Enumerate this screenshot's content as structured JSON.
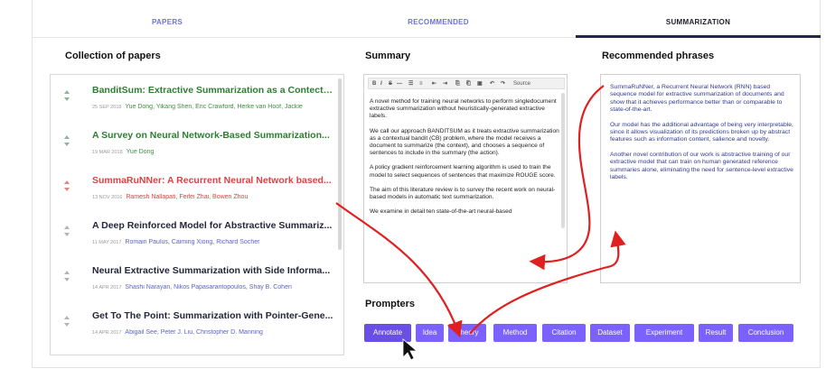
{
  "tabs": [
    {
      "label": "PAPERS",
      "active": false
    },
    {
      "label": "RECOMMENDED",
      "active": false
    },
    {
      "label": "SUMMARIZATION",
      "active": true
    }
  ],
  "collection": {
    "title": "Collection of papers",
    "papers": [
      {
        "title": "BanditSum: Extractive Summarization as a Contectu...",
        "date": "25 SEP 2018",
        "authors": "Yue Dong, Yikang Shen, Eric Crawford, Herke van Hoof, Jackie",
        "state": "green"
      },
      {
        "title": "A Survey on Neural Network-Based Summarization...",
        "date": "19 MAR 2018",
        "authors": "Yue Dong",
        "state": "green"
      },
      {
        "title": "SummaRuNNer: A Recurrent Neural Network based...",
        "date": "13 NOV 2016",
        "authors": "Ramesh Nallapati, Feifei Zhai, Bowen Zhou",
        "state": "red"
      },
      {
        "title": "A Deep Reinforced Model for Abstractive Summariz...",
        "date": "11 MAY 2017",
        "authors": "Romain Paulus, Caiming Xiong, Richard Socher",
        "state": "normal"
      },
      {
        "title": "Neural Extractive Summarization with Side Informa...",
        "date": "14 APR 2017",
        "authors": "Shashi Narayan, Nikos Papasarantopoulos, Shay B. Cohen",
        "state": "normal"
      },
      {
        "title": "Get To The Point: Summarization with Pointer-Gene...",
        "date": "14 APR 2017",
        "authors": "Abigail See, Peter J. Liu, Christopher D. Manning",
        "state": "normal"
      }
    ]
  },
  "summary": {
    "title": "Summary",
    "toolbar": [
      "B",
      "I",
      "S",
      "—",
      "☰",
      "≡",
      "⇤",
      "⇥",
      "⎘",
      "⎗",
      "▣",
      "↶",
      "↷",
      "Source"
    ],
    "paragraphs": [
      "A novel method for training neural networks to perform singledocument extractive summarization without heuristically-generated extractive labels.",
      "We call our approach BANDITSUM as it treats extractive summarization as a contextual bandit (CB) problem, where the model receives a document to summarize (the context), and chooses a sequence of sentences to include in the summary (the action).",
      "A policy gradient reinforcement learning algorithm is used to train the model to select sequences of sentences that maximize ROUGE score.",
      "The aim of this literature review is to survey the recent work on neural-based models in automatic text summarization.",
      "We examine in detail ten state-of-the-art neural-based"
    ]
  },
  "phrases": {
    "title": "Recommended phrases",
    "paragraphs": [
      "SummaRuNNer, a Recurrent Neural Network (RNN) based sequence model for extractive summarization of documents and show that it achieves performance better than or comparable to state-of-the-art.",
      "Our model has the additional advantage of being very interpretable, since it allows visualization of its predictions broken up by abstract features  such as information content, salience and novelty.",
      "Another novel contribution of our work is abstractive training of our extractive model that can train on human generated reference summaries alone, eliminating the need for sentence-level extractive labels."
    ]
  },
  "prompters": {
    "title": "Prompters",
    "buttons": [
      "Annotate",
      "Idea",
      "Theory",
      "Method",
      "Citation",
      "Dataset",
      "Experiment",
      "Result",
      "Conclusion"
    ]
  },
  "colors": {
    "accent": "#7b61ff",
    "green": "#2e7d32",
    "red": "#d84343",
    "link": "#5a63c6",
    "annotation": "#e02020"
  }
}
